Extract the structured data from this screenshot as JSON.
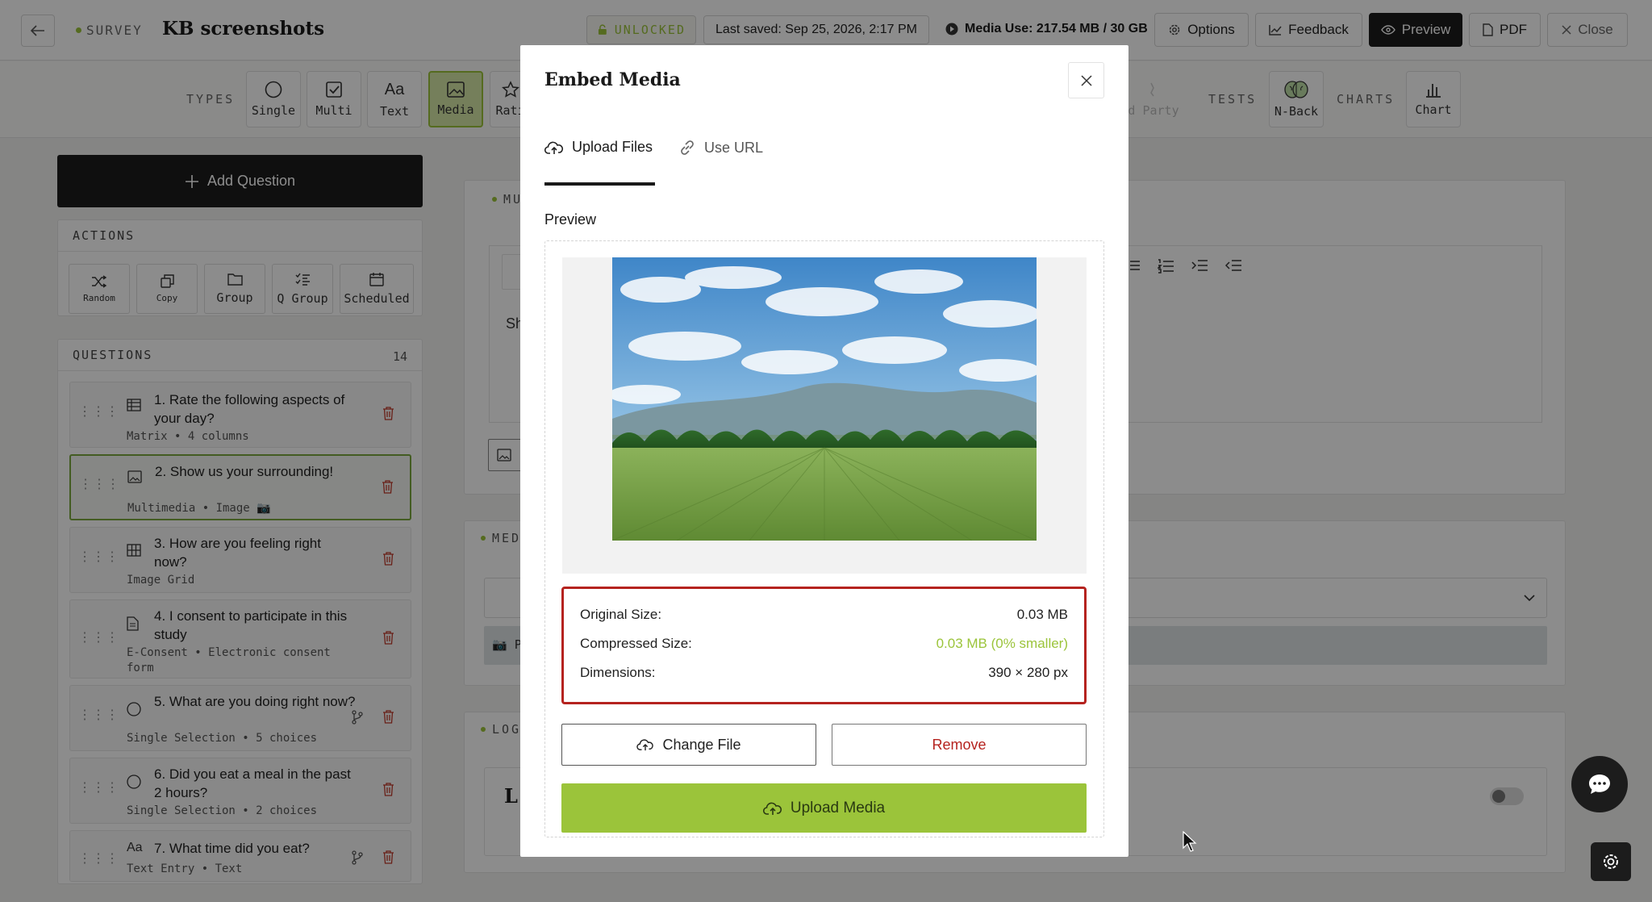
{
  "header": {
    "brand_label": "SURVEY",
    "title": "KB screenshots",
    "unlocked_label": "UNLOCKED",
    "last_saved": "Last saved: Sep 25, 2026, 2:17 PM",
    "media_use": "Media Use: 217.54 MB / 30 GB",
    "options_label": "Options",
    "feedback_label": "Feedback",
    "preview_label": "Preview",
    "pdf_label": "PDF",
    "close_label": "Close"
  },
  "types_bar": {
    "types_label": "TYPES",
    "types": [
      "Single",
      "Multi",
      "Text",
      "Media",
      "Rati"
    ],
    "active_type": "Media",
    "third_party_label": "d Party",
    "tests_label": "TESTS",
    "tests": [
      "N-Back"
    ],
    "charts_label": "CHARTS",
    "charts": [
      "Chart"
    ]
  },
  "sidebar": {
    "add_question_label": "Add Question",
    "actions_label": "ACTIONS",
    "actions": [
      "Random",
      "Copy",
      "Group",
      "Q Group",
      "Scheduled"
    ],
    "questions_label": "QUESTIONS",
    "questions_count": "14",
    "questions": [
      {
        "title": "1. Rate the following aspects of your day?",
        "meta": "Matrix • 4 columns",
        "icon": "matrix-icon"
      },
      {
        "title": "2. Show us your surrounding!",
        "meta": "Multimedia • Image 📷",
        "icon": "image-icon"
      },
      {
        "title": "3. How are you feeling right now?",
        "meta": "Image Grid",
        "icon": "grid-icon"
      },
      {
        "title": "4. I consent to participate in this study",
        "meta": "E-Consent • Electronic consent form",
        "icon": "document-icon"
      },
      {
        "title": "5. What are you doing right now?",
        "meta": "Single Selection • 5 choices",
        "icon": "radio-icon"
      },
      {
        "title": "6. Did you eat a meal in the past 2 hours?",
        "meta": "Single Selection • 2 choices",
        "icon": "radio-icon"
      },
      {
        "title": "7. What time did you eat?",
        "meta": "Text Entry • Text",
        "icon": "text-icon"
      }
    ]
  },
  "background_content": {
    "card1_label": "MU",
    "card1_text": "Sh",
    "card2_label": "MEDI",
    "card2_text": "📷 P",
    "card3_label": "LOGI",
    "card3_heading": "L"
  },
  "modal": {
    "title": "Embed Media",
    "tabs": [
      "Upload Files",
      "Use URL"
    ],
    "active_tab": "Upload Files",
    "preview_label": "Preview",
    "original_size_label": "Original Size:",
    "original_size_value": "0.03 MB",
    "compressed_size_label": "Compressed Size:",
    "compressed_size_value": "0.03 MB (0% smaller)",
    "dimensions_label": "Dimensions:",
    "dimensions_value": "390 × 280 px",
    "change_file_label": "Change File",
    "remove_label": "Remove",
    "upload_label": "Upload Media"
  },
  "colors": {
    "accent_green": "#9bc43a",
    "danger_red": "#b5231f",
    "dark": "#1c1c1c"
  }
}
